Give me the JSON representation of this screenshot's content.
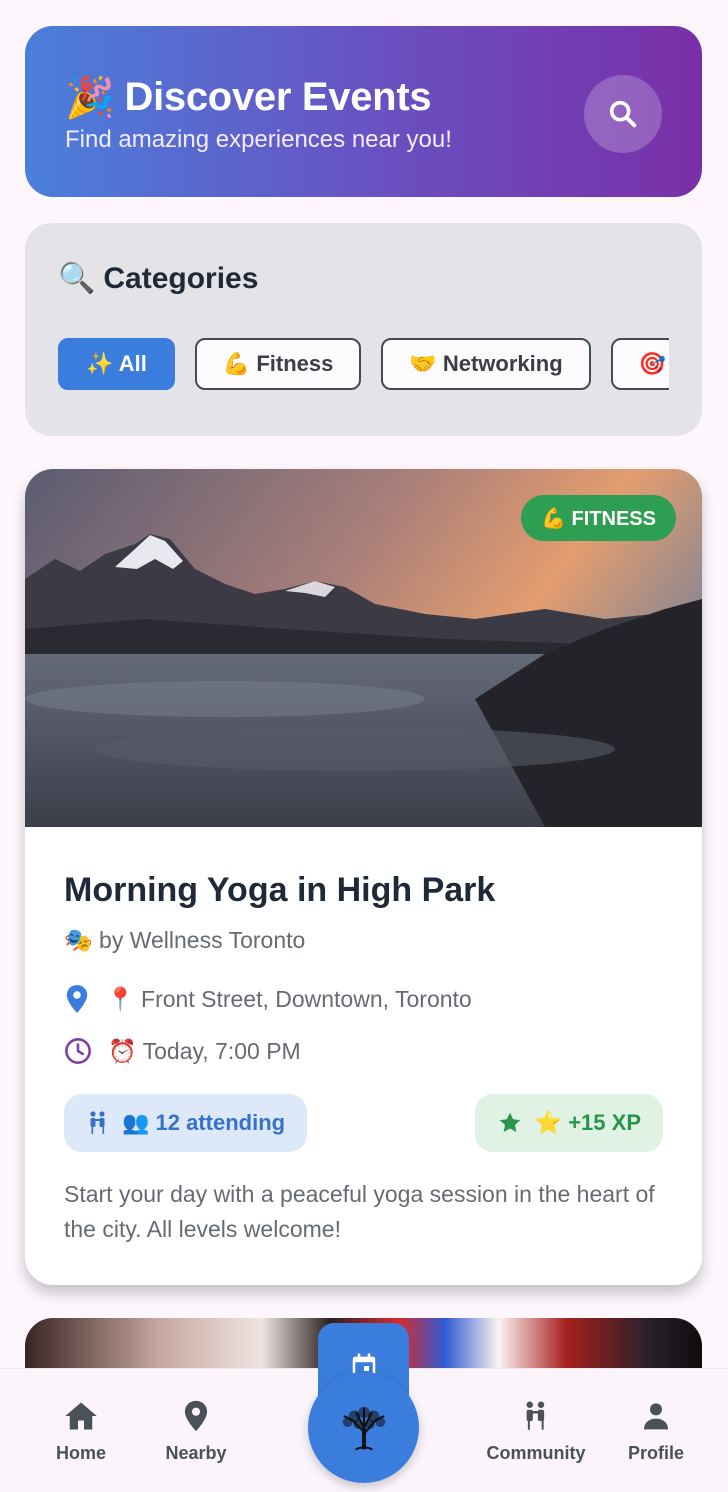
{
  "header": {
    "emoji": "🎉",
    "title": "Discover Events",
    "subtitle": "Find amazing experiences near you!"
  },
  "categories": {
    "emoji": "🔍",
    "title": "Categories",
    "chips": [
      {
        "label": "✨ All",
        "active": true
      },
      {
        "label": "💪 Fitness",
        "active": false
      },
      {
        "label": "🤝 Networking",
        "active": false
      },
      {
        "label": "🎯 S",
        "active": false
      }
    ]
  },
  "event": {
    "badge": "💪 FITNESS",
    "title": "Morning Yoga in High Park",
    "organizer": "🎭 by Wellness Toronto",
    "location": "📍 Front Street, Downtown, Toronto",
    "time": "⏰ Today, 7:00 PM",
    "attending": "👥 12 attending",
    "xp": "⭐ +15 XP",
    "description": "Start your day with a peaceful yoga session in the heart of the city. All levels welcome!"
  },
  "nav": {
    "home": "Home",
    "nearby": "Nearby",
    "community": "Community",
    "profile": "Profile"
  },
  "colors": {
    "primary": "#3b7ddd",
    "header_gradient_start": "#4a7fdc",
    "header_gradient_end": "#7a2fa8",
    "fitness_green": "#2e9e52"
  }
}
